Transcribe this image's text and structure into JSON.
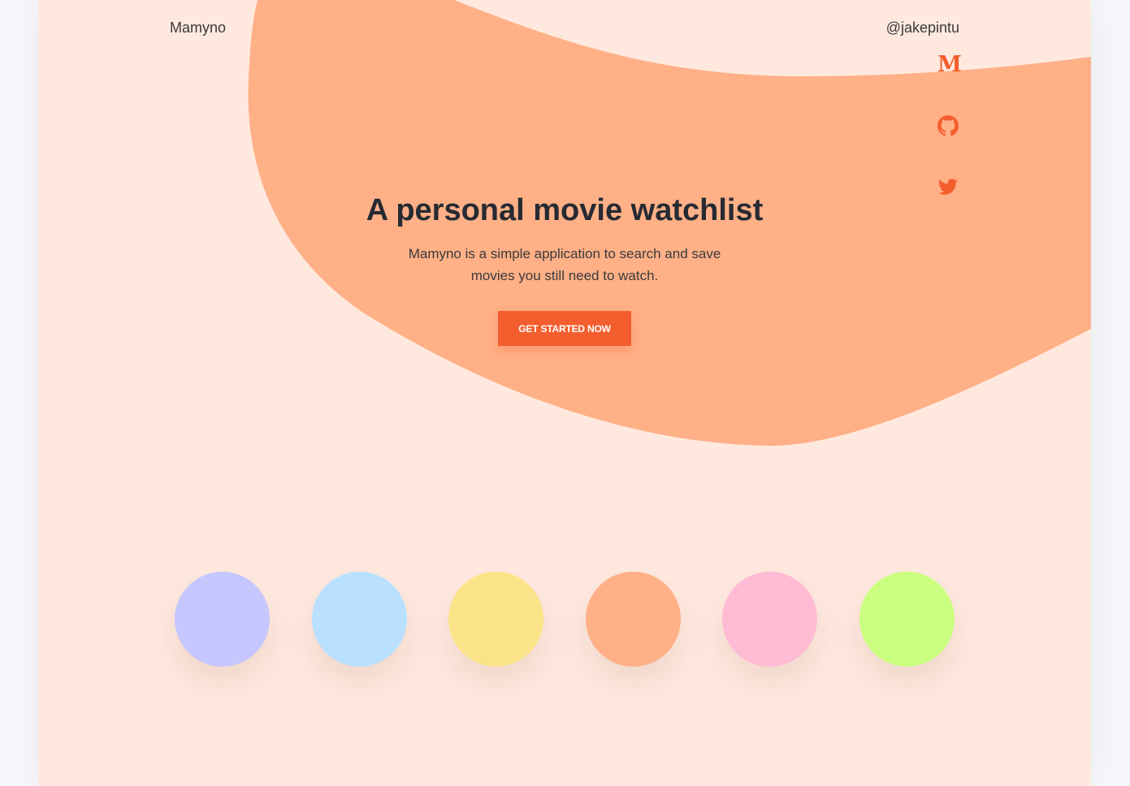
{
  "header": {
    "brand": "Mamyno",
    "handle": "@jakepintu"
  },
  "social": [
    {
      "name": "medium",
      "glyph": "M",
      "icon": "medium-icon"
    },
    {
      "name": "github",
      "icon": "github-icon"
    },
    {
      "name": "twitter",
      "icon": "twitter-icon"
    }
  ],
  "hero": {
    "title": "A personal movie watchlist",
    "description": "Mamyno is a simple application to search and save movies you still need to watch.",
    "cta_label": "GET STARTED NOW"
  },
  "colors": {
    "accent": "#f45e2e",
    "blob": "#ffb087",
    "page_bg": "#ffe9df"
  },
  "swatches": [
    {
      "name": "lavender",
      "color": "#c7c7ff"
    },
    {
      "name": "light-blue",
      "color": "#b9e0ff"
    },
    {
      "name": "yellow",
      "color": "#fbe389"
    },
    {
      "name": "peach",
      "color": "#ffb087"
    },
    {
      "name": "pink",
      "color": "#ffbad4"
    },
    {
      "name": "lime",
      "color": "#cbff80"
    }
  ]
}
